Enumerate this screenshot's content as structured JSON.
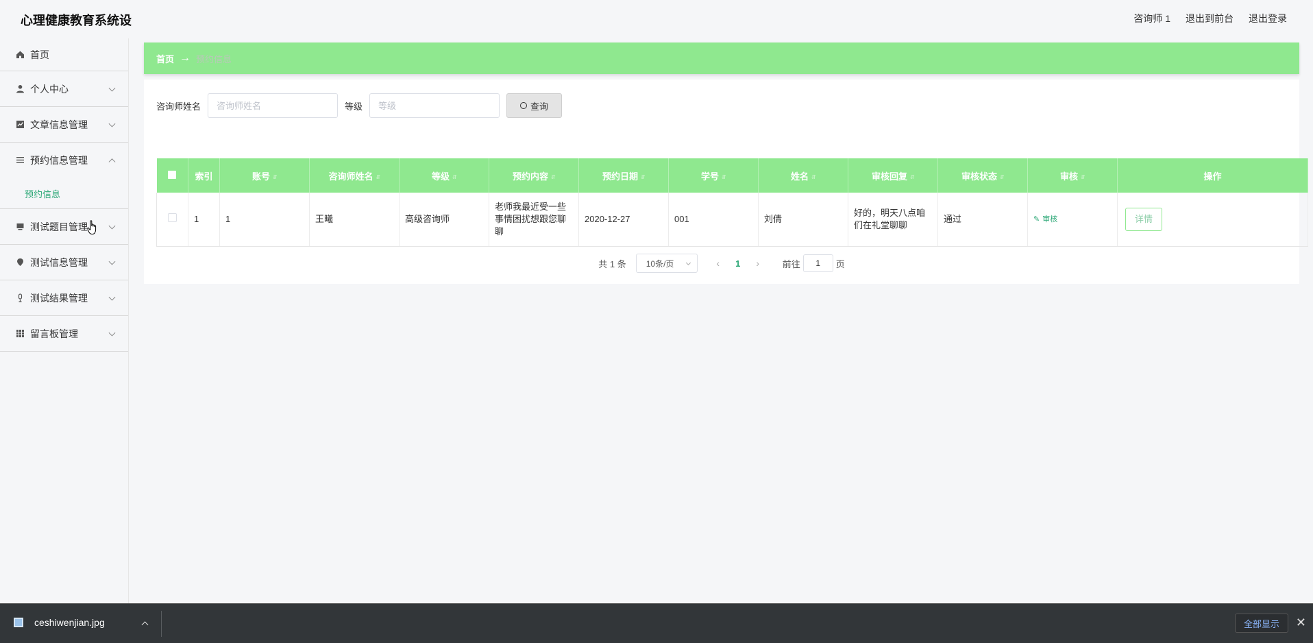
{
  "header": {
    "title": "心理健康教育系统设",
    "user": "咨询师 1",
    "back_to_front": "退出到前台",
    "logout": "退出登录"
  },
  "sidebar": {
    "items": [
      {
        "label": "首页",
        "icon": "home-icon"
      },
      {
        "label": "个人中心",
        "icon": "user-icon"
      },
      {
        "label": "文章信息管理",
        "icon": "chart-icon"
      },
      {
        "label": "预约信息管理",
        "icon": "list-icon",
        "expanded": true,
        "children": [
          {
            "label": "预约信息"
          }
        ]
      },
      {
        "label": "测试题目管理",
        "icon": "monitor-icon"
      },
      {
        "label": "测试信息管理",
        "icon": "pin-icon"
      },
      {
        "label": "测试结果管理",
        "icon": "mic-icon"
      },
      {
        "label": "留言板管理",
        "icon": "grid-icon"
      }
    ]
  },
  "breadcrumb": {
    "home": "首页",
    "separator": "→",
    "current": "预约信息"
  },
  "search": {
    "counselor_label": "咨询师姓名",
    "counselor_placeholder": "咨询师姓名",
    "level_label": "等级",
    "level_placeholder": "等级",
    "button": "查询"
  },
  "table": {
    "columns": [
      "索引",
      "账号",
      "咨询师姓名",
      "等级",
      "预约内容",
      "预约日期",
      "学号",
      "姓名",
      "审核回复",
      "审核状态",
      "审核",
      "操作"
    ],
    "rows": [
      {
        "index": "1",
        "account": "1",
        "counselor": "王曦",
        "level": "高级咨询师",
        "content": "老师我最近受一些事情困扰想跟您聊聊",
        "date": "2020-12-27",
        "student_id": "001",
        "name": "刘倩",
        "reply": "好的，明天八点咱们在礼堂聊聊",
        "status": "通过",
        "audit_label": "审核",
        "detail_label": "详情"
      }
    ]
  },
  "pagination": {
    "total": "共 1 条",
    "page_size": "10条/页",
    "current_page": "1",
    "goto_prefix": "前往",
    "goto_value": "1",
    "goto_suffix": "页"
  },
  "download_bar": {
    "filename": "ceshiwenjian.jpg",
    "show_all": "全部显示"
  },
  "colors": {
    "accent_green": "#8fe88f",
    "link_green": "#2aa775",
    "download_bar_bg": "#323639"
  }
}
